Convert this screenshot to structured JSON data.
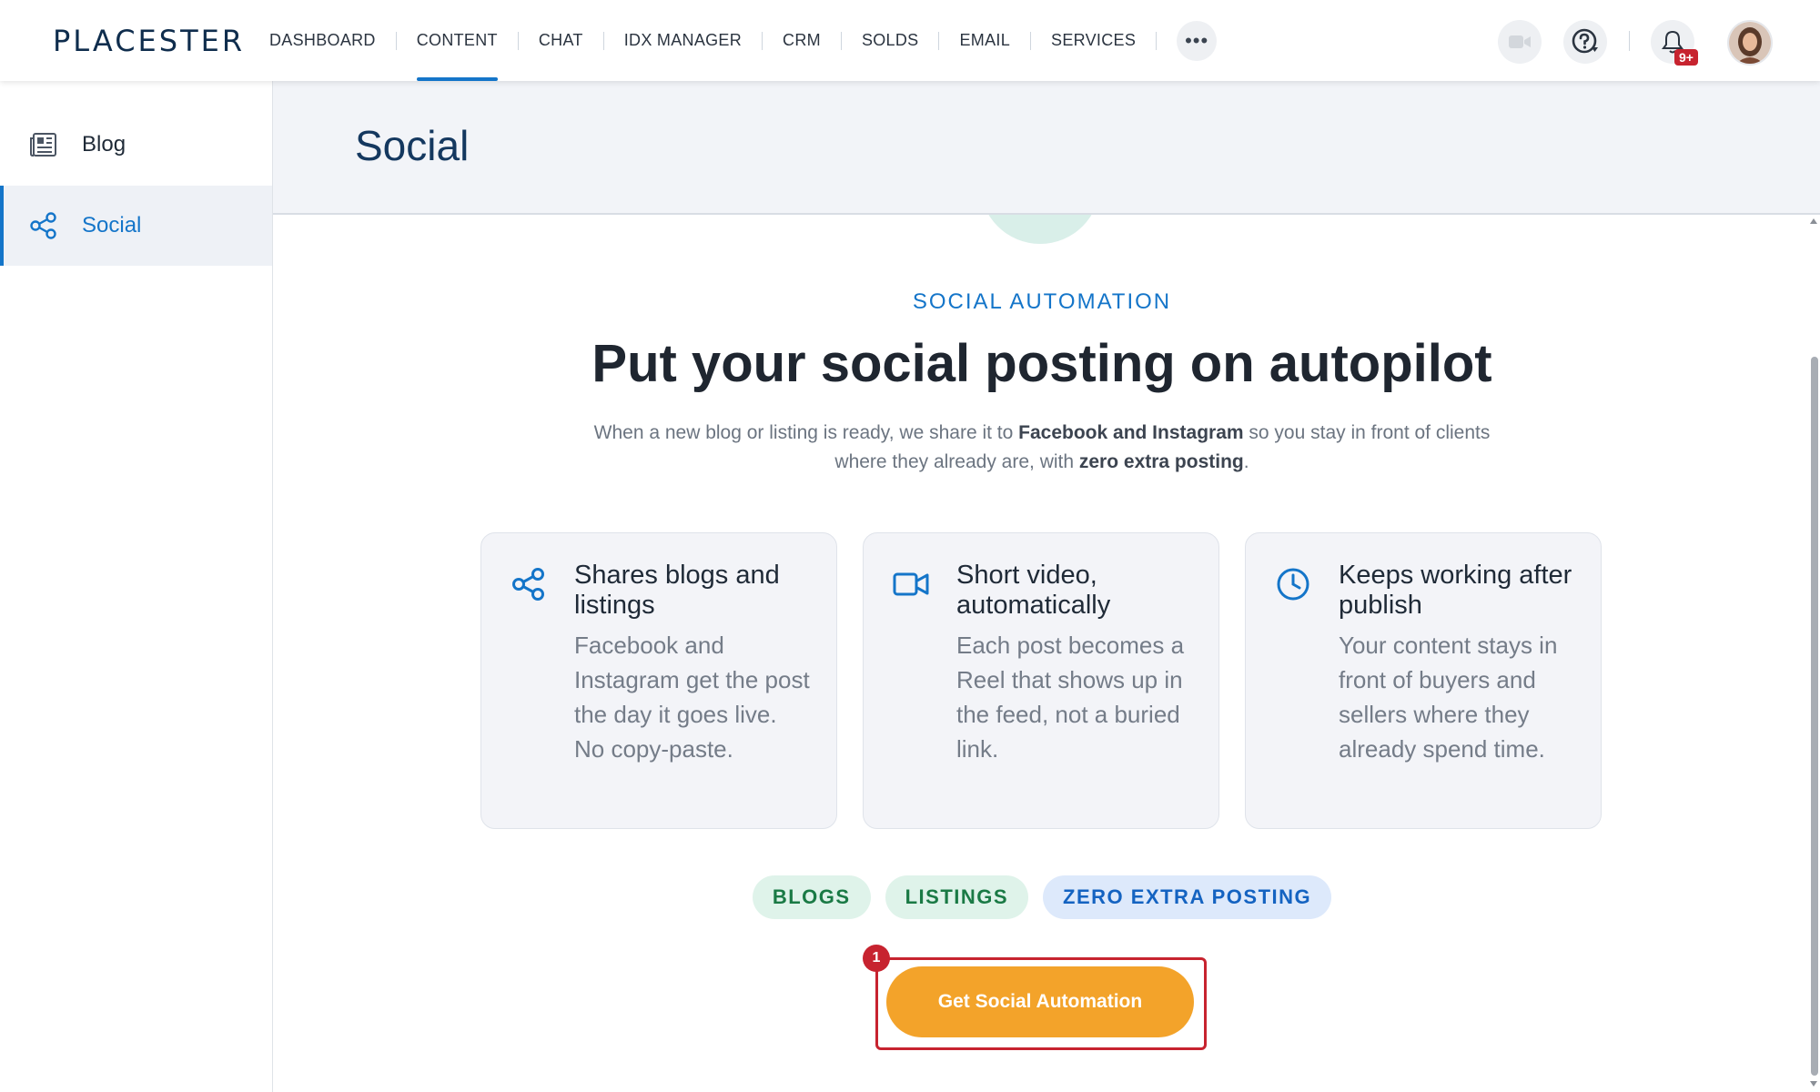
{
  "header": {
    "logo": "PLACESTER",
    "nav": [
      {
        "label": "DASHBOARD",
        "active": false
      },
      {
        "label": "CONTENT",
        "active": true
      },
      {
        "label": "CHAT",
        "active": false
      },
      {
        "label": "IDX MANAGER",
        "active": false
      },
      {
        "label": "CRM",
        "active": false
      },
      {
        "label": "SOLDS",
        "active": false
      },
      {
        "label": "EMAIL",
        "active": false
      },
      {
        "label": "SERVICES",
        "active": false
      }
    ],
    "more_label": "•••",
    "notification_badge": "9+"
  },
  "sidebar": {
    "items": [
      {
        "label": "Blog",
        "icon": "newspaper-icon",
        "active": false
      },
      {
        "label": "Social",
        "icon": "share-icon",
        "active": true
      }
    ]
  },
  "page": {
    "title": "Social",
    "eyebrow": "SOCIAL AUTOMATION",
    "headline": "Put your social posting on autopilot",
    "subtext": {
      "part1": "When a new blog or listing is ready, we share it to ",
      "bold1": "Facebook and Instagram",
      "part2": " so you stay in front of clients where they already are, with ",
      "bold2": "zero extra posting",
      "part3": "."
    },
    "cards": [
      {
        "icon": "share-icon",
        "title": "Shares blogs and listings",
        "body": "Facebook and Instagram get the post the day it goes live. No copy-paste."
      },
      {
        "icon": "video-icon",
        "title": "Short video, automatically",
        "body": "Each post becomes a Reel that shows up in the feed, not a buried link."
      },
      {
        "icon": "clock-icon",
        "title": "Keeps working after publish",
        "body": "Your content stays in front of buyers and sellers where they already spend time."
      }
    ],
    "chips": [
      "BLOGS",
      "LISTINGS",
      "ZERO EXTRA POSTING"
    ],
    "cta_label": "Get Social Automation",
    "marker_label": "1"
  },
  "colors": {
    "accent": "#1475c9",
    "cta": "#f3a32a",
    "highlight": "#c7232f"
  }
}
